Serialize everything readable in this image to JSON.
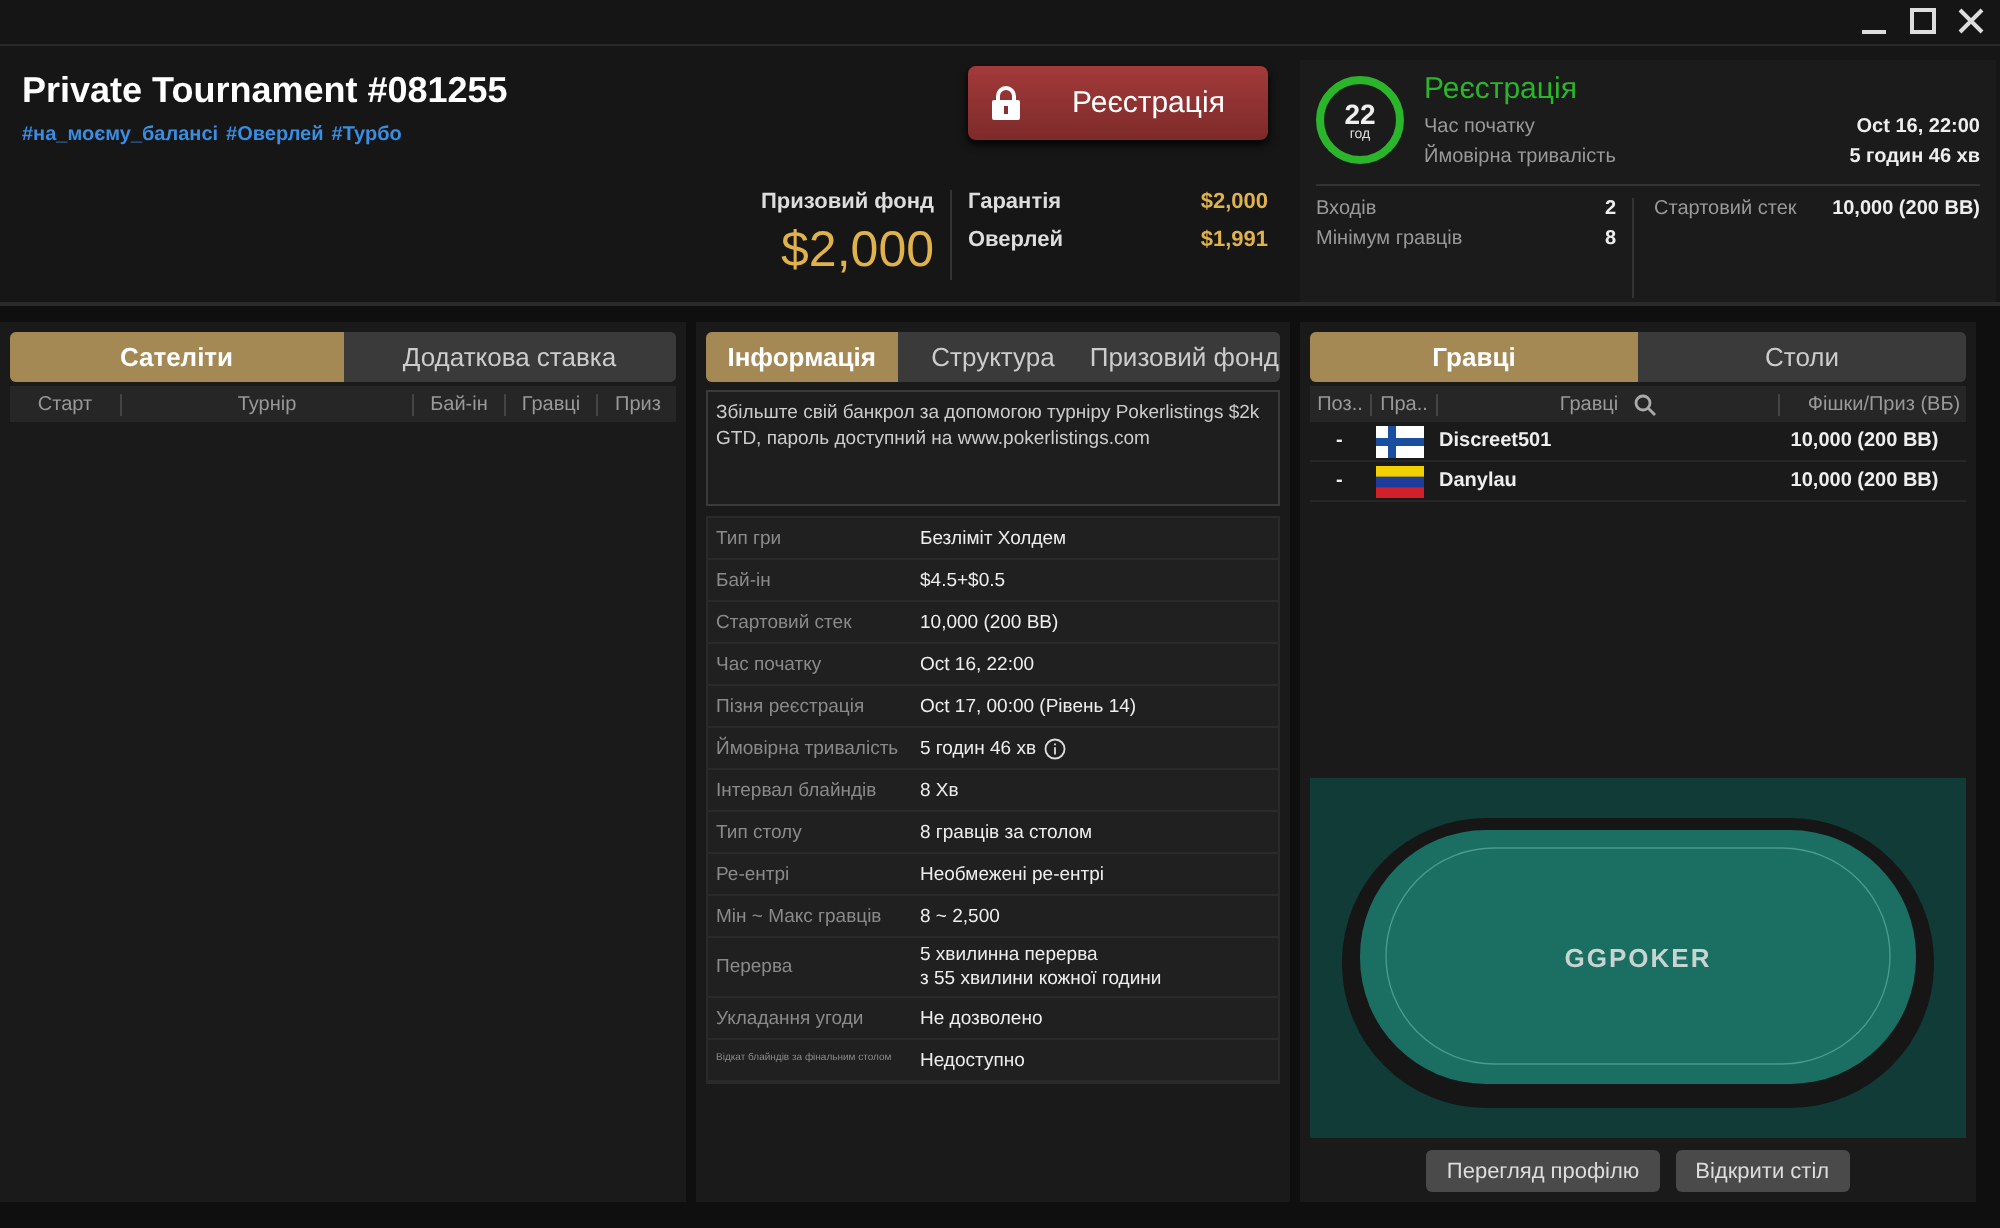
{
  "window": {
    "controls": [
      {
        "kind": "minimize"
      },
      {
        "kind": "maximize"
      },
      {
        "kind": "close"
      }
    ]
  },
  "header": {
    "title": "Private Tournament #081255",
    "tags": [
      "#на_моєму_балансі",
      "#Оверлей",
      "#Турбо"
    ],
    "register_button": "Реєстрація",
    "prize_label": "Призовий фонд",
    "prize_value": "$2,000",
    "prize_details": [
      {
        "label": "Гарантія",
        "value": "$2,000"
      },
      {
        "label": "Оверлей",
        "value": "$1,991"
      }
    ]
  },
  "status": {
    "countdown": "22",
    "unit": "год",
    "title": "Реєстрація",
    "rows": [
      {
        "label": "Час початку",
        "value": "Oct 16, 22:00"
      },
      {
        "label": "Ймовірна тривалість",
        "value": "5 годин 46 хв"
      }
    ],
    "stats_left": [
      {
        "label": "Входів",
        "value": "2"
      },
      {
        "label": "Мінімум гравців",
        "value": "8"
      }
    ],
    "stats_right": [
      {
        "label": "Стартовий стек",
        "value": "10,000 (200 BB)"
      }
    ]
  },
  "left_panel": {
    "tabs": [
      {
        "label": "Сателіти",
        "selected": true
      },
      {
        "label": "Додаткова ставка",
        "selected": false
      }
    ],
    "columns": [
      "Старт",
      "Турнір",
      "Бай-ін",
      "Гравці",
      "Приз"
    ]
  },
  "info_panel": {
    "tabs": [
      {
        "label": "Інформація",
        "selected": true
      },
      {
        "label": "Структура",
        "selected": false
      },
      {
        "label": "Призовий фонд",
        "selected": false
      }
    ],
    "description": "Збільште свій банкрол за допомогою турніру Pokerlistings $2k GTD, пароль доступний на www.pokerlistings.com",
    "rows": [
      {
        "label": "Тип гри",
        "value": "Безліміт Холдем"
      },
      {
        "label": "Бай-ін",
        "value": "$4.5+$0.5"
      },
      {
        "label": "Стартовий стек",
        "value": "10,000 (200 BB)"
      },
      {
        "label": "Час початку",
        "value": "Oct 16, 22:00"
      },
      {
        "label": "Пізня реєстрація",
        "value": "Oct 17, 00:00 (Рівень 14)"
      },
      {
        "label": "Ймовірна тривалість",
        "value": "5 годин 46 хв",
        "info": true
      },
      {
        "label": "Інтервал блайндів",
        "value": "8 Хв"
      },
      {
        "label": "Тип столу",
        "value": "8 гравців за столом"
      },
      {
        "label": "Ре-ентрі",
        "value": "Необмежені ре-ентрі"
      },
      {
        "label": "Мін ~ Макс гравців",
        "value": "8 ~ 2,500"
      },
      {
        "label": "Перерва",
        "value": "5 хвилинна перерва",
        "value2": "з 55 хвилини кожної години"
      },
      {
        "label": "Укладання угоди",
        "value": "Не дозволено"
      },
      {
        "label": "Відкат блайндів за фінальним столом",
        "value": "Недоступно",
        "small": true
      }
    ]
  },
  "players_panel": {
    "tabs": [
      {
        "label": "Гравці",
        "selected": true
      },
      {
        "label": "Столи",
        "selected": false
      }
    ],
    "columns": [
      "Поз..",
      "Пра..",
      "Гравці",
      "Фішки/Приз (ВБ)"
    ],
    "rows": [
      {
        "position": "-",
        "kind": "finland",
        "name": "Discreet501",
        "chips": "10,000 (200 BB)"
      },
      {
        "position": "-",
        "kind": "venezuela",
        "name": "Danylau",
        "chips": "10,000 (200 BB)"
      }
    ],
    "table_logo": "GGPOKER",
    "buttons": [
      "Перегляд профілю",
      "Відкрити стіл"
    ]
  }
}
